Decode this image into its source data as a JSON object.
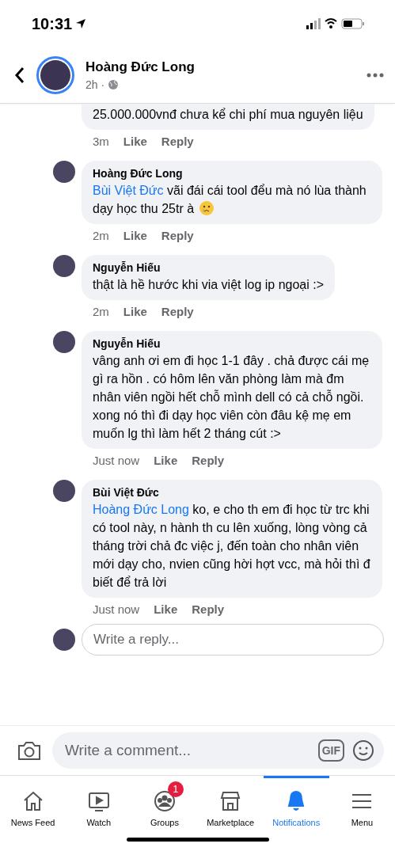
{
  "status_bar": {
    "time": "10:31"
  },
  "header": {
    "author": "Hoàng Đức Long",
    "age": "2h ·"
  },
  "comments": [
    {
      "kind": "partial",
      "text": "25.000.000vnđ chưa kể chi phí mua nguyên liệu",
      "time": "3m",
      "like": "Like",
      "reply": "Reply"
    },
    {
      "kind": "emoji",
      "author": "Hoàng Đức Long",
      "mention": "Bùi Việt Đức",
      "text": " vãi đái cái tool đểu mà nó lùa thành dạy học thu 25tr à",
      "time": "2m",
      "like": "Like",
      "reply": "Reply"
    },
    {
      "kind": "plain",
      "author": "Nguyễn Hiếu",
      "text": "thật là hề hước khi via việt log ip ngoại :>",
      "time": "2m",
      "like": "Like",
      "reply": "Reply"
    },
    {
      "kind": "plain",
      "author": "Nguyễn Hiếu",
      "text": "vâng anh ơi em đi học 1-1 đây . chả được cái mẹ gì ra hồn . có hôm lên văn phòng làm mà đm nhân viên ngồi hết chỗ mình dell có cả chỗ ngồi. xong nó thì đi dạy học viên còn đâu kệ mẹ em muốn lg thì làm hết 2 tháng cút :>",
      "time": "Just now",
      "like": "Like",
      "reply": "Reply"
    },
    {
      "kind": "plain",
      "author": "Bùi Việt Đức",
      "mention": "Hoàng Đức Long",
      "text": " ko, e cho th em đi học từ trc khi có tool này, n hành th cu lên xuống, lòng vòng cả tháng trời chả đc việc j, đến toàn cho nhân viên mới dạy cho, nvien cũng hời hợt vcc, mà hỏi thì đ biết để trả lời",
      "time": "Just now",
      "like": "Like",
      "reply": "Reply"
    }
  ],
  "reply_field": {
    "placeholder": "Write a reply..."
  },
  "comment_bar": {
    "placeholder": "Write a comment...",
    "gif": "GIF"
  },
  "nav": [
    {
      "kind": "home",
      "label": "News Feed",
      "selected": false
    },
    {
      "kind": "watch",
      "label": "Watch",
      "selected": false
    },
    {
      "kind": "groups",
      "label": "Groups",
      "selected": false,
      "badge": "1"
    },
    {
      "kind": "market",
      "label": "Marketplace",
      "selected": false
    },
    {
      "kind": "bell",
      "label": "Notifications",
      "selected": true
    },
    {
      "kind": "menu",
      "label": "Menu",
      "selected": false
    }
  ]
}
